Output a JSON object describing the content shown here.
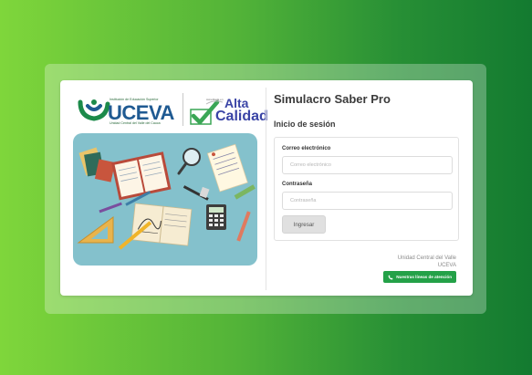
{
  "logos": {
    "uceva_tagline": "Institución de Educación Superior",
    "uceva_name": "UCEVA",
    "uceva_subtitle": "Unidad Central del Valle del Cauca",
    "accreditation_small": "Acreditada en",
    "accreditation_word1": "Alta",
    "accreditation_word2": "Calidad"
  },
  "header": {
    "title": "Simulacro Saber Pro",
    "subtitle": "Inicio de sesión"
  },
  "form": {
    "email_label": "Correo electrónico",
    "email_placeholder": "Correo electrónico",
    "email_value": "",
    "password_label": "Contraseña",
    "password_placeholder": "Contraseña",
    "password_value": "",
    "submit_label": "Ingresar"
  },
  "footer": {
    "institution_name": "Unidad Central del Valle",
    "institution_abbr": "UCEVA",
    "support_button_label": "Nuestras líneas de atención",
    "support_icon": "phone-icon"
  },
  "colors": {
    "background_gradient_start": "#7fd63b",
    "background_gradient_end": "#137a30",
    "brand_blue": "#1f5a92",
    "accreditation_purple": "#3a44a6",
    "support_green": "#24a148",
    "illustration_bg": "#84c1cc"
  }
}
